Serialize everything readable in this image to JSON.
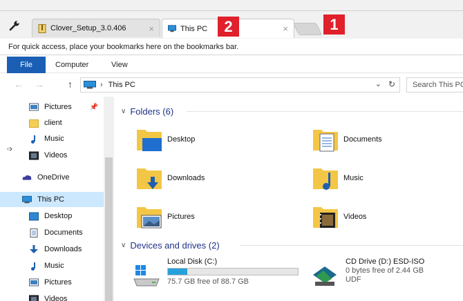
{
  "browser": {
    "tabs": [
      {
        "label": "Clover_Setup_3.0.406",
        "close": "×"
      },
      {
        "label": "This PC",
        "close": "×"
      }
    ],
    "bookmark_bar_text": "For quick access, place your bookmarks here on the bookmarks bar.",
    "annotations": [
      "2",
      "1"
    ]
  },
  "ribbon": {
    "tabs": [
      "File",
      "Computer",
      "View"
    ],
    "accent": "#1a5fb4"
  },
  "address": {
    "path": "This PC",
    "search_placeholder": "Search This PC"
  },
  "navpane": {
    "items": [
      {
        "label": "Pictures",
        "icon": "pictures-icon",
        "pinned": true
      },
      {
        "label": "client",
        "icon": "folder-icon"
      },
      {
        "label": "Music",
        "icon": "music-icon"
      },
      {
        "label": "Videos",
        "icon": "videos-icon"
      },
      {
        "label": "OneDrive",
        "icon": "onedrive-icon"
      },
      {
        "label": "This PC",
        "icon": "this-pc-icon",
        "selected": true
      },
      {
        "label": "Desktop",
        "icon": "desktop-icon"
      },
      {
        "label": "Documents",
        "icon": "documents-icon"
      },
      {
        "label": "Downloads",
        "icon": "downloads-icon"
      },
      {
        "label": "Music",
        "icon": "music-icon"
      },
      {
        "label": "Pictures",
        "icon": "pictures-icon"
      },
      {
        "label": "Videos",
        "icon": "videos-icon"
      }
    ]
  },
  "content": {
    "folders_header": "Folders (6)",
    "folders": [
      {
        "label": "Desktop",
        "icon": "desktop-folder-icon"
      },
      {
        "label": "Documents",
        "icon": "documents-folder-icon"
      },
      {
        "label": "Downloads",
        "icon": "downloads-folder-icon"
      },
      {
        "label": "Music",
        "icon": "music-folder-icon"
      },
      {
        "label": "Pictures",
        "icon": "pictures-folder-icon"
      },
      {
        "label": "Videos",
        "icon": "videos-folder-icon"
      }
    ],
    "drives_header": "Devices and drives (2)",
    "drives": [
      {
        "label": "Local Disk (C:)",
        "info": "75.7 GB free of 88.7 GB",
        "used_fraction": 0.147,
        "icon": "windows-drive-icon"
      },
      {
        "label": "CD Drive (D:) ESD-ISO",
        "info": "0 bytes free of 2.44 GB",
        "info2": "UDF",
        "icon": "cd-drive-icon"
      }
    ]
  }
}
